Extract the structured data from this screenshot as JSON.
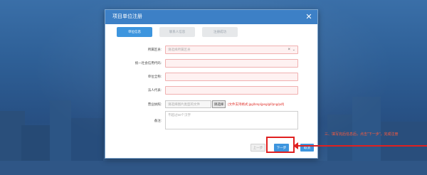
{
  "modal": {
    "title": "项目单位注册",
    "close_glyph": "✕"
  },
  "steps": [
    {
      "label": "单位信息",
      "active": true
    },
    {
      "label": "联系人信息",
      "active": false
    },
    {
      "label": "注册成功",
      "active": false
    }
  ],
  "form": {
    "region": {
      "label": "所属区县:",
      "placeholder": "请选择所属区县"
    },
    "credit_code": {
      "label": "统一社会信用代码:"
    },
    "full_name": {
      "label": "单位全称:"
    },
    "legal_rep": {
      "label": "法人代表:"
    },
    "license": {
      "label": "营业执照:",
      "placeholder": "请选择图片类型的文件",
      "choose_label": "请选择",
      "hint": "(文件支持格式:jpg/bmp/jpeg/gif/png/pdf)"
    },
    "remark": {
      "label": "备注:",
      "placeholder": "不超过50个汉字"
    }
  },
  "buttons": {
    "prev": "上一步",
    "next": "下一步",
    "cancel": "取消"
  },
  "annotation": {
    "text": "三、填写完后信息后，点击\"下一步\"，完成注册",
    "color": "#e02020"
  },
  "colors": {
    "header": "#3d80c6",
    "primary": "#3d95de",
    "required_border": "#f0b0b0",
    "hint": "#e0302a"
  }
}
